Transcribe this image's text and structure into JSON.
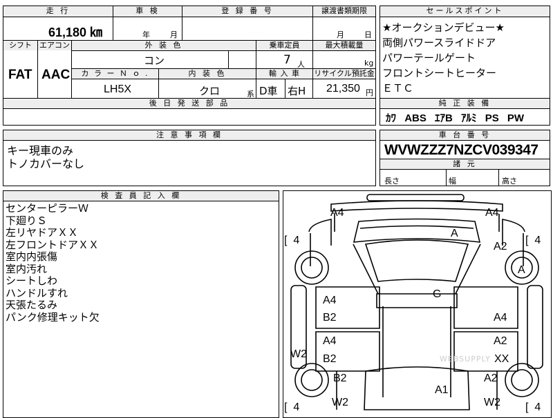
{
  "top_row": {
    "mileage_label": "走 行",
    "mileage_value": "61,180 ㎞",
    "inspection_label": "車 検",
    "inspection_year": "年",
    "inspection_month": "月",
    "registration_label": "登 録 番 号",
    "transfer_label": "譲渡書類期限",
    "transfer_month": "月",
    "transfer_day": "日"
  },
  "second_row": {
    "shift_label": "シフト",
    "shift_value": "FAT",
    "ac_label": "エアコン",
    "ac_value": "AAC",
    "exterior_label": "外 装 色",
    "exterior_value": "コン",
    "capacity_label": "乗車定員",
    "capacity_value": "7",
    "capacity_unit": "人",
    "load_label": "最大積載量",
    "load_unit": "kg",
    "colorno_label": "カ ラ ー Ｎ ｏ .",
    "colorno_value": "LH5X",
    "interior_label": "内 装 色",
    "interior_value": "クロ",
    "interior_unit": "系",
    "import_label": "輸 入 車",
    "import_drive": "D車",
    "import_steer": "右H",
    "recycle_label": "リサイクル預託金",
    "recycle_value": "21,350",
    "recycle_unit": "円",
    "shipping_label": "後 日 発 送 部 品"
  },
  "sales_points": {
    "header": "セールスポイント",
    "items": [
      "★オークションデビュー★",
      "両側パワースライドドア",
      "パワーテールゲート",
      "フロントシートヒーター",
      "ＥＴＣ"
    ],
    "equipment_header": "純 正 装 備",
    "equipment_items": [
      "ｶﾜ",
      "ABS",
      "ｴｱB",
      "ｱﾙﾐ",
      "PS",
      "PW"
    ]
  },
  "notes": {
    "header": "注 意 事 項 欄",
    "lines": [
      "キー現車のみ",
      "トノカバーなし"
    ]
  },
  "chassis": {
    "header": "車 台 番 号",
    "value": "WVWZZZ7NZCV039347",
    "dims_header": "諸 元",
    "length_label": "長さ",
    "width_label": "幅",
    "height_label": "高さ"
  },
  "inspector": {
    "header": "検 査 員 記 入 欄",
    "lines": [
      "センターピラーＷ",
      "下廻りＳ",
      "左リヤドアＸＸ",
      "左フロントドアＸＸ",
      "室内内張傷",
      "室内汚れ",
      "シートしわ",
      "ハンドルすれ",
      "天張たるみ",
      "パンク修理キット欠"
    ]
  },
  "diagram": {
    "marks": {
      "a4_front_left": "A4",
      "a4_front_right": "A4",
      "a_windshield": "A",
      "a2_front_right": "A2",
      "a_wheel_right": "A",
      "g_roof": "G",
      "a4_left_rear_door_top": "A4",
      "b2_left_rear_door": "B2",
      "a4_right_rear_door": "A4",
      "a4_left_front_door": "A4",
      "a2_right_front_door": "A2",
      "b2_left_front_door": "B2",
      "xx_right": "XX",
      "w2_left_side": "W2",
      "b2_left_rear": "B2",
      "a1_rear": "A1",
      "a2_rear_right": "A2",
      "w2_rear_left": "W2",
      "w2_rear_right": "W2"
    },
    "tires": {
      "front_left": "4",
      "front_right": "4",
      "rear_left": "4",
      "rear_right": "4"
    },
    "watermark": "WEBSUPPLY"
  }
}
